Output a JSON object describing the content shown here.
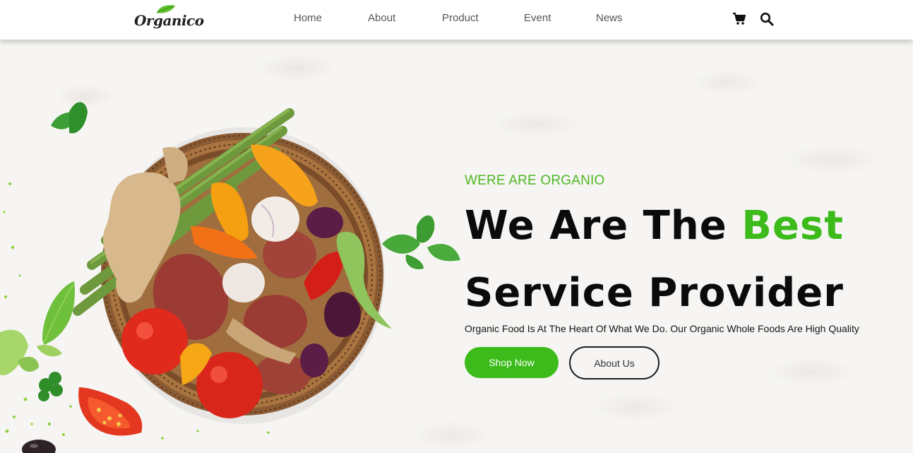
{
  "header": {
    "logo_text": "Organico",
    "nav": [
      {
        "label": "Home"
      },
      {
        "label": "About"
      },
      {
        "label": "Product"
      },
      {
        "label": "Event"
      },
      {
        "label": "News"
      }
    ],
    "icons": [
      "cart-icon",
      "search-icon"
    ]
  },
  "hero": {
    "tagline": "WERE ARE ORGANIO",
    "headline_line1_part1": "We Are The ",
    "headline_line1_accent": "Best",
    "headline_line2": "Service Provider",
    "subtext": "Organic Food Is At The Heart Of What We Do. Our Organic Whole Foods Are High Quality",
    "primary_button": "Shop Now",
    "secondary_button": "About Us"
  },
  "colors": {
    "accent": "#3dbb1b",
    "tagline": "#4fb724",
    "text": "#0b0b0b",
    "background": "#f6f5f3"
  }
}
